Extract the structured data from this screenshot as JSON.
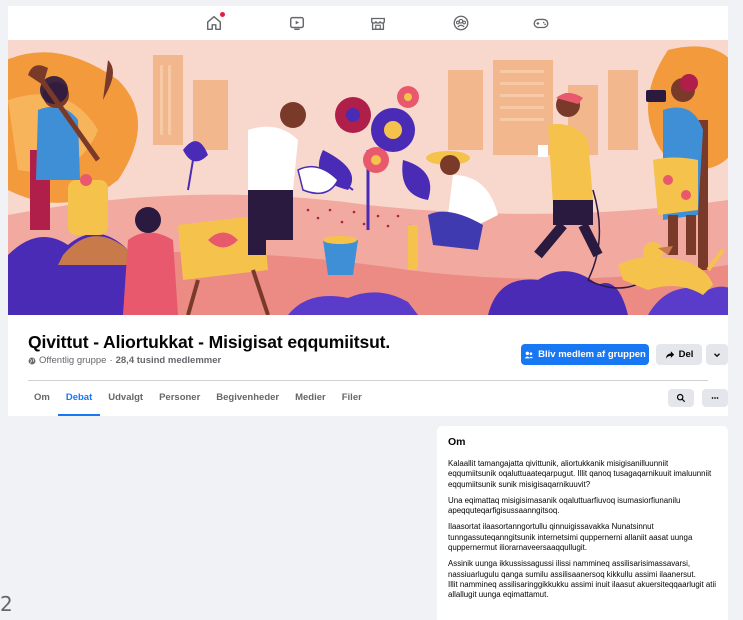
{
  "nav": {
    "icons": [
      "home-icon",
      "video-icon",
      "marketplace-icon",
      "groups-icon",
      "gaming-icon"
    ]
  },
  "cover": {
    "description_icons": [
      "city-skyline",
      "gardeners",
      "flowers",
      "dog"
    ]
  },
  "group": {
    "title": "Qivittut - Aliortukkat - Misigisat eqqumiitsut.",
    "privacy": "Offentlig gruppe",
    "separator": "·",
    "members": "28,4 tusind medlemmer",
    "join_label": "Bliv medlem af gruppen",
    "share_label": "Del"
  },
  "tabs": [
    "Om",
    "Debat",
    "Udvalgt",
    "Personer",
    "Begivenheder",
    "Medier",
    "Filer"
  ],
  "active_tab": "Debat",
  "about": {
    "heading": "Om",
    "paragraphs": [
      "Kalaallit tamangajatta qivittunik, aliortukkanik misigisanilluunniit eqqumiitsunik oqaluttuaateqarpugut. Illit qanoq tusagaqarnikuuit imaluunniit eqqumiitsunik sunik misigisaqarnikuuvit?",
      "Una eqimattaq misigisimasanik oqaluttuarfiuvoq isumasiorfiunanilu apeqquteqarfigisussaanngitsoq.",
      "Ilaasortat ilaasortanngortullu qinnuigissavakka Nunatsinnut tunngassuteqanngitsunik internetsimi quppernerni allaniit aasat uunga quppernermut iliorarnaveersaaqqullugit.",
      "Assinik uunga ikkussissagussi ilissi nammineq assilisarisimassavarsi, nassiuarlugulu qanga sumilu assilisaanersoq kikkullu assimi ilaanersut.",
      "Illit nammineq assilisaringgikkukku assimi inuit ilaasut akuersiteqqaarlugit atii allallugit uunga eqimattamut."
    ]
  },
  "page_number": "2",
  "colors": {
    "accent": "#1877f2",
    "background": "#f0f2f5",
    "secondary_text": "#65676b"
  }
}
